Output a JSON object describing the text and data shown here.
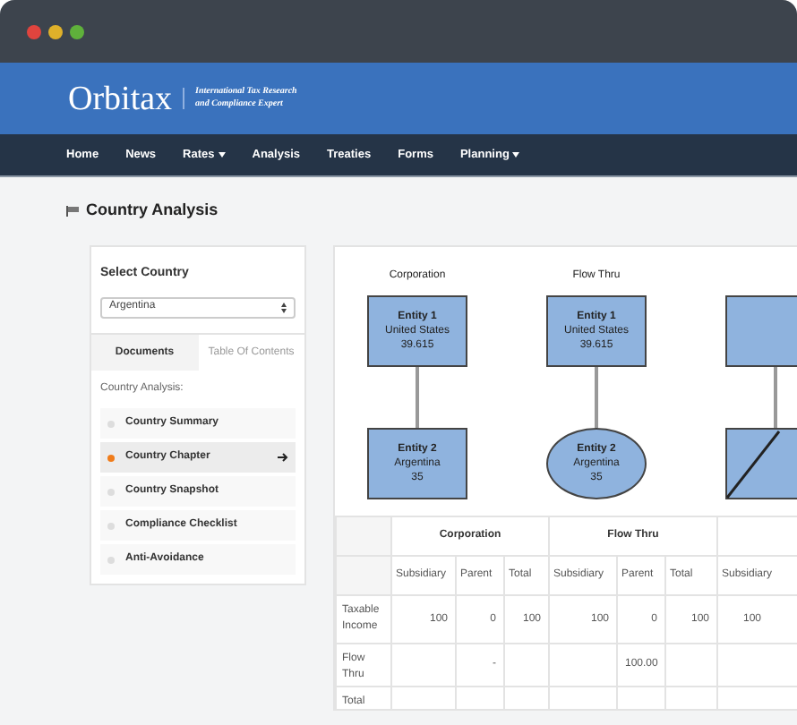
{
  "window": {
    "controls": [
      {
        "color": "#e0443e"
      },
      {
        "color": "#dfb12a"
      },
      {
        "color": "#5fb13b"
      }
    ]
  },
  "brand": {
    "logo": "Orbitax",
    "tagline_1": "International Tax Research",
    "tagline_2": "and Compliance Expert"
  },
  "nav": [
    {
      "label": "Home",
      "has_menu": false
    },
    {
      "label": "News",
      "has_menu": false
    },
    {
      "label": "Rates",
      "has_menu": true
    },
    {
      "label": "Analysis",
      "has_menu": false
    },
    {
      "label": "Treaties",
      "has_menu": false
    },
    {
      "label": "Forms",
      "has_menu": false
    },
    {
      "label": "Planning",
      "has_menu": true
    }
  ],
  "page_title": "Country Analysis",
  "select_country": {
    "title": "Select Country",
    "value": "Argentina"
  },
  "tabs": [
    {
      "label": "Documents",
      "selected": true
    },
    {
      "label": "Table Of Contents",
      "selected": false
    }
  ],
  "list_label": "Country Analysis:",
  "items": [
    {
      "label": "Country Summary",
      "selected": false
    },
    {
      "label": "Country Chapter",
      "selected": true
    },
    {
      "label": "Country Snapshot",
      "selected": false
    },
    {
      "label": "Compliance Checklist",
      "selected": false
    },
    {
      "label": "Anti-Avoidance",
      "selected": false
    }
  ],
  "diagrams": [
    {
      "title": "Corporation",
      "parent": {
        "name": "Entity 1",
        "country": "United States",
        "value": "39.615"
      },
      "child": {
        "kind": "box",
        "name": "Entity 2",
        "country": "Argentina",
        "value": "35"
      }
    },
    {
      "title": "Flow Thru",
      "parent": {
        "name": "Entity 1",
        "country": "United States",
        "value": "39.615"
      },
      "child": {
        "kind": "ellipse",
        "name": "Entity 2",
        "country": "Argentina",
        "value": "35"
      }
    },
    {
      "child": {
        "kind": "diagonal"
      }
    }
  ],
  "table": {
    "groups": [
      {
        "title": "Corporation"
      },
      {
        "title": "Flow Thru"
      }
    ],
    "columns": [
      "Subsidiary",
      "Parent",
      "Total",
      "Subsidiary",
      "Parent",
      "Total",
      "Subsidiary"
    ],
    "rows": [
      {
        "label": "Taxable Income",
        "cells": [
          "100",
          "0",
          "100",
          "100",
          "0",
          "100",
          "100"
        ]
      },
      {
        "label": "Flow Thru",
        "cells": [
          "",
          "-",
          "",
          "",
          "100.00",
          "",
          ""
        ]
      },
      {
        "label": "Total",
        "cells": [
          "",
          "",
          "",
          "",
          "",
          "",
          ""
        ]
      }
    ]
  }
}
